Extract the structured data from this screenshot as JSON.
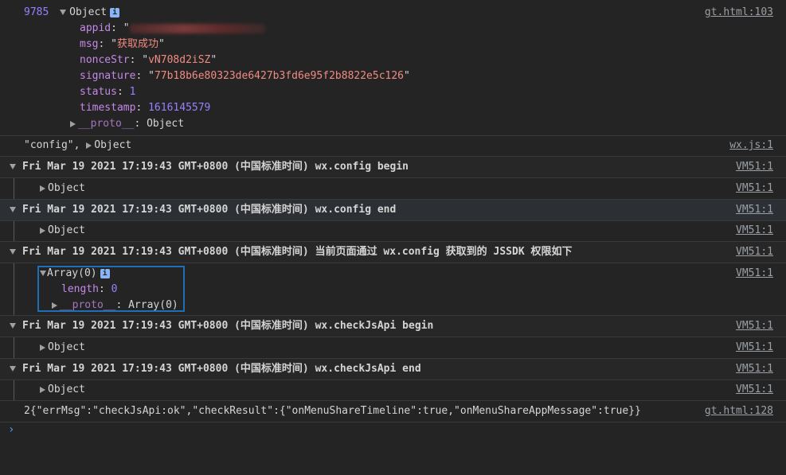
{
  "entry1": {
    "count": "9785",
    "type_label": "Object",
    "info_icon": "i",
    "fields": [
      {
        "key": "appid",
        "value": "\""
      },
      {
        "key": "msg",
        "value": "获取成功"
      },
      {
        "key": "nonceStr",
        "value": "vN708d2iSZ"
      },
      {
        "key": "signature",
        "value": "77b18b6e80323de6427b3fd6e95f2b8822e5c126"
      },
      {
        "key": "status",
        "value": "1"
      },
      {
        "key": "timestamp",
        "value": "1616145579"
      }
    ],
    "proto_key": "__proto__",
    "proto_value": "Object",
    "source": "gt.html:103"
  },
  "entry2": {
    "prefix": "\"config\",",
    "object": "Object",
    "source": "wx.js:1"
  },
  "groups": [
    {
      "header": "Fri Mar 19 2021 17:19:43 GMT+0800 (中国标准时间) wx.config begin",
      "source": "VM51:1",
      "child": "Object",
      "child_source": "VM51:1"
    },
    {
      "header": "Fri Mar 19 2021 17:19:43 GMT+0800 (中国标准时间) wx.config end",
      "source": "VM51:1",
      "child": "Object",
      "child_source": "VM51:1"
    },
    {
      "header": "Fri Mar 19 2021 17:19:43 GMT+0800 (中国标准时间) 当前页面通过 wx.config 获取到的 JSSDK 权限如下",
      "source": "VM51:1",
      "child": "Array(0)",
      "child_source": "VM51:1",
      "length_key": "length",
      "length_value": "0",
      "proto_key": "__proto__",
      "proto_value": "Array(0)"
    },
    {
      "header": "Fri Mar 19 2021 17:19:43 GMT+0800 (中国标准时间) wx.checkJsApi begin",
      "source": "VM51:1",
      "child": "Object",
      "child_source": "VM51:1"
    },
    {
      "header": "Fri Mar 19 2021 17:19:43 GMT+0800 (中国标准时间) wx.checkJsApi end",
      "source": "VM51:1",
      "child": "Object",
      "child_source": "VM51:1"
    }
  ],
  "final": {
    "text": "2{\"errMsg\":\"checkJsApi:ok\",\"checkResult\":{\"onMenuShareTimeline\":true,\"onMenuShareAppMessage\":true}}",
    "source": "gt.html:128"
  },
  "prompt": "›",
  "icons": {
    "expanded": "triangle-down",
    "collapsed": "triangle-right",
    "info": "info-badge"
  }
}
